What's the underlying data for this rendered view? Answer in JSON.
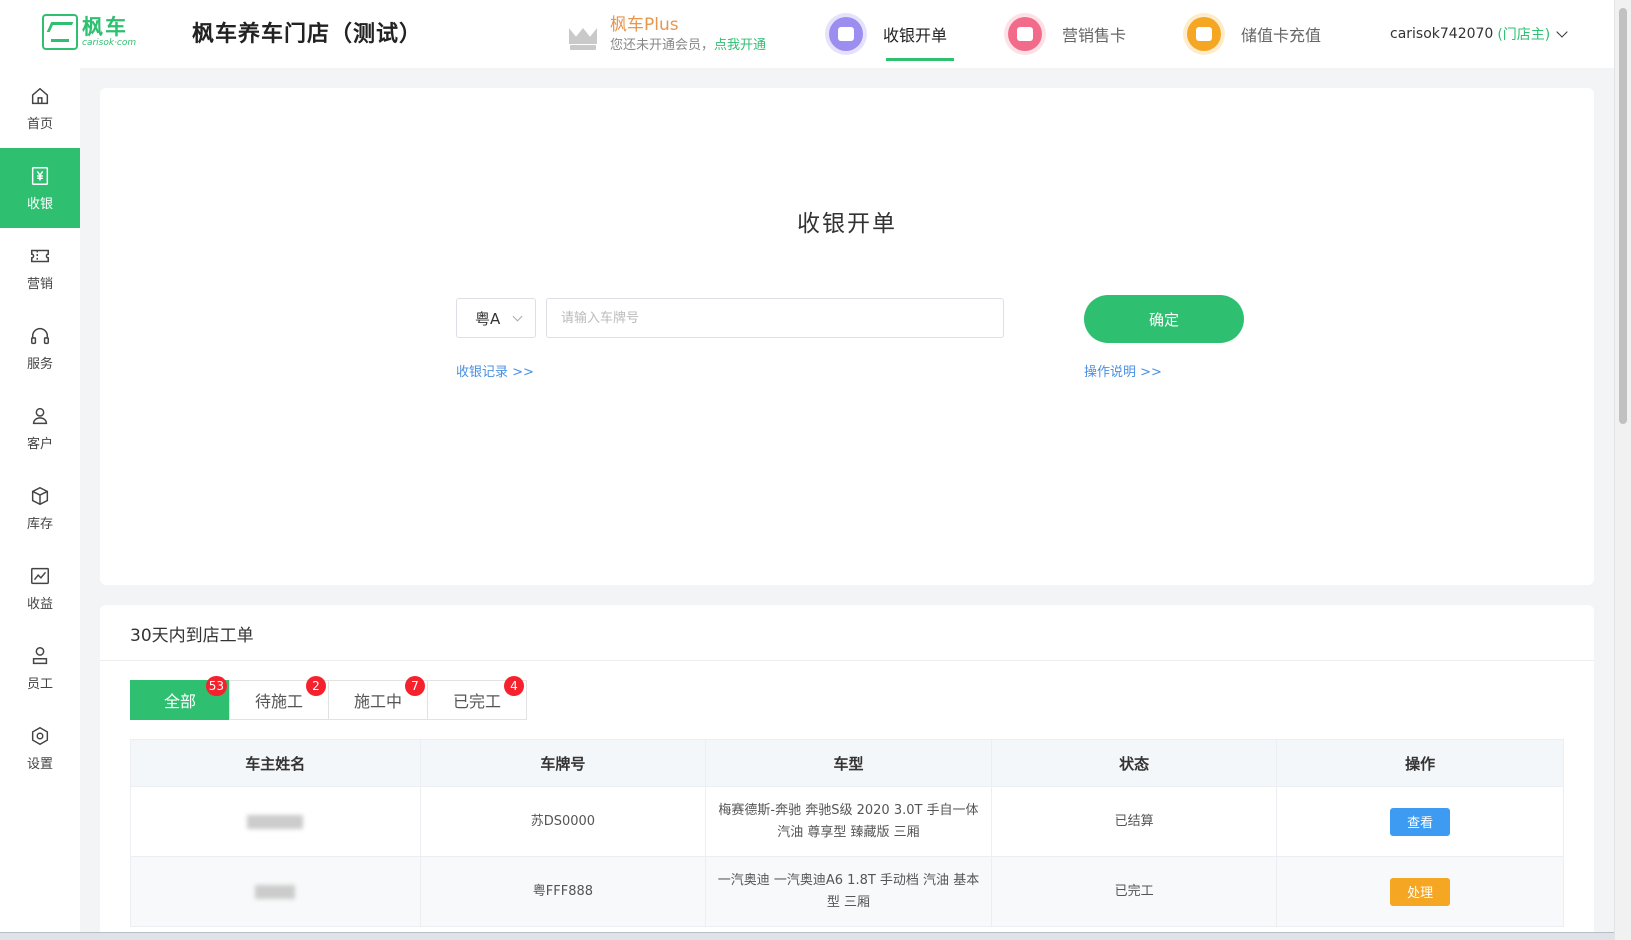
{
  "header": {
    "logo_cn": "枫车",
    "logo_en": "carisok·com",
    "store_name": "枫车养车门店（测试）",
    "plus": {
      "title": "枫车Plus",
      "sub_prefix": "您还未开通会员，",
      "sub_action": "点我开通"
    },
    "nav": [
      {
        "label": "收银开单",
        "icon": "cashier-icon",
        "color": "#9b8ef0"
      },
      {
        "label": "营销售卡",
        "icon": "card-icon",
        "color": "#f26b8a"
      },
      {
        "label": "储值卡充值",
        "icon": "wallet-icon",
        "color": "#f5a623"
      }
    ],
    "user": {
      "account": "carisok742070",
      "role": "(门店主)"
    }
  },
  "sidebar": {
    "items": [
      {
        "label": "首页",
        "icon": "home-icon"
      },
      {
        "label": "收银",
        "icon": "yen-icon"
      },
      {
        "label": "营销",
        "icon": "ticket-icon"
      },
      {
        "label": "服务",
        "icon": "headset-icon"
      },
      {
        "label": "客户",
        "icon": "user-icon"
      },
      {
        "label": "库存",
        "icon": "box-icon"
      },
      {
        "label": "收益",
        "icon": "chart-icon"
      },
      {
        "label": "员工",
        "icon": "staff-icon"
      },
      {
        "label": "设置",
        "icon": "settings-icon"
      }
    ],
    "active_index": 1
  },
  "cashier": {
    "title": "收银开单",
    "province": "粤A",
    "plate_placeholder": "请输入车牌号",
    "confirm": "确定",
    "records_link": "收银记录 >>",
    "help_link": "操作说明 >>"
  },
  "orders": {
    "title": "30天内到店工单",
    "tabs": [
      {
        "label": "全部",
        "count": "53"
      },
      {
        "label": "待施工",
        "count": "2"
      },
      {
        "label": "施工中",
        "count": "7"
      },
      {
        "label": "已完工",
        "count": "4"
      }
    ],
    "columns": [
      "车主姓名",
      "车牌号",
      "车型",
      "状态",
      "操作"
    ],
    "rows": [
      {
        "owner": "",
        "plate": "苏DS0000",
        "model": "梅赛德斯-奔驰 奔驰S级 2020 3.0T 手自一体 汽油 尊享型 臻藏版 三厢",
        "status": "已结算",
        "action": "查看"
      },
      {
        "owner": "",
        "plate": "粤FFF888",
        "model": "一汽奥迪 一汽奥迪A6 1.8T 手动档 汽油 基本型 三厢",
        "status": "已完工",
        "action": "处理"
      }
    ]
  },
  "colors": {
    "brand": "#2fbf71",
    "link": "#4a90e2",
    "badge": "#f5222d",
    "view_button": "#3d9bf2",
    "handle_button": "#f5a623"
  }
}
